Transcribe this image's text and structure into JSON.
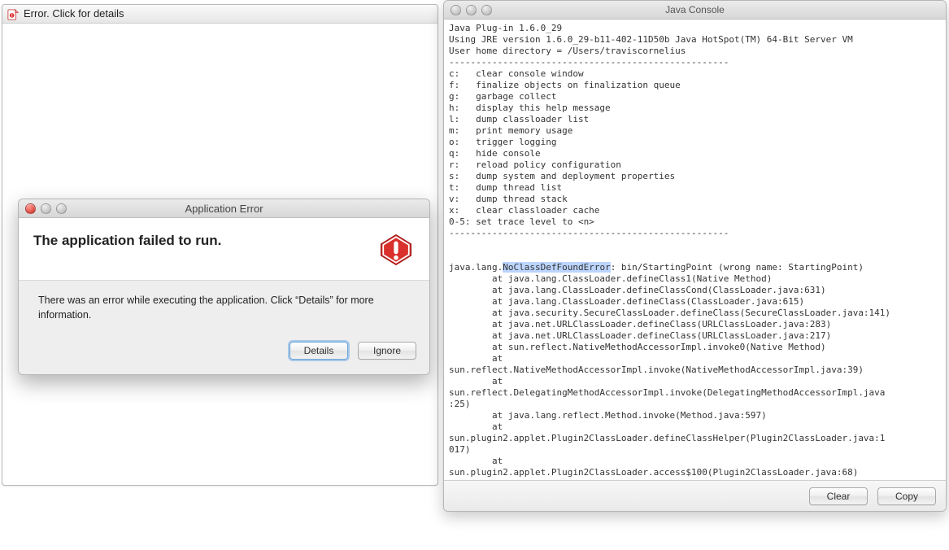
{
  "bg_window": {
    "title": "Error.  Click for details"
  },
  "modal": {
    "window_title": "Application Error",
    "heading": "The application failed to run.",
    "message": "There was an error while executing the application.  Click “Details” for more information.",
    "buttons": {
      "details": "Details",
      "ignore": "Ignore"
    }
  },
  "console": {
    "window_title": "Java Console",
    "buttons": {
      "clear": "Clear",
      "copy": "Copy"
    },
    "highlight": "NoClassDefFoundError",
    "pre": "Java Plug-in 1.6.0_29",
    "lines": [
      "Java Plug-in 1.6.0_29",
      "Using JRE version 1.6.0_29-b11-402-11D50b Java HotSpot(TM) 64-Bit Server VM",
      "User home directory = /Users/traviscornelius",
      "----------------------------------------------------",
      "c:   clear console window",
      "f:   finalize objects on finalization queue",
      "g:   garbage collect",
      "h:   display this help message",
      "l:   dump classloader list",
      "m:   print memory usage",
      "o:   trigger logging",
      "q:   hide console",
      "r:   reload policy configuration",
      "s:   dump system and deployment properties",
      "t:   dump thread list",
      "v:   dump thread stack",
      "x:   clear classloader cache",
      "0-5: set trace level to <n>",
      "----------------------------------------------------",
      "",
      "",
      "java.lang.NoClassDefFoundError: bin/StartingPoint (wrong name: StartingPoint)",
      "        at java.lang.ClassLoader.defineClass1(Native Method)",
      "        at java.lang.ClassLoader.defineClassCond(ClassLoader.java:631)",
      "        at java.lang.ClassLoader.defineClass(ClassLoader.java:615)",
      "        at java.security.SecureClassLoader.defineClass(SecureClassLoader.java:141)",
      "        at java.net.URLClassLoader.defineClass(URLClassLoader.java:283)",
      "        at java.net.URLClassLoader.defineClass(URLClassLoader.java:217)",
      "        at sun.reflect.NativeMethodAccessorImpl.invoke0(Native Method)",
      "        at ",
      "sun.reflect.NativeMethodAccessorImpl.invoke(NativeMethodAccessorImpl.java:39)",
      "        at ",
      "sun.reflect.DelegatingMethodAccessorImpl.invoke(DelegatingMethodAccessorImpl.java",
      ":25)",
      "        at java.lang.reflect.Method.invoke(Method.java:597)",
      "        at ",
      "sun.plugin2.applet.Plugin2ClassLoader.defineClassHelper(Plugin2ClassLoader.java:1",
      "017)",
      "        at ",
      "sun.plugin2.applet.Plugin2ClassLoader.access$100(Plugin2ClassLoader.java:68)",
      "        at "
    ]
  }
}
